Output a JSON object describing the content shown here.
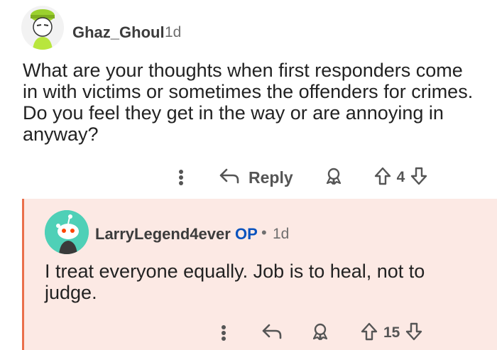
{
  "comment": {
    "username": "Ghaz_Ghoul",
    "age": "1d",
    "body": "What are your thoughts when first responders come in with victims or sometimes the offenders for crimes. Do you feel they get in the way or are annoying in anyway?",
    "actions": {
      "reply_label": "Reply",
      "vote_count": "4"
    }
  },
  "reply": {
    "username": "LarryLegend4ever",
    "op_badge": "OP",
    "separator": "•",
    "age": "1d",
    "body": "I treat everyone equally. Job is to heal, not to judge.",
    "actions": {
      "vote_count": "15"
    }
  },
  "colors": {
    "reply_background": "#fce9e4",
    "reply_thread_line": "#ea6f4b",
    "op_badge": "#0a53be",
    "avatar_teal": "#4fd0b7"
  },
  "icons": [
    "more-options-icon",
    "reply-arrow-icon",
    "award-icon",
    "upvote-icon",
    "downvote-icon"
  ]
}
